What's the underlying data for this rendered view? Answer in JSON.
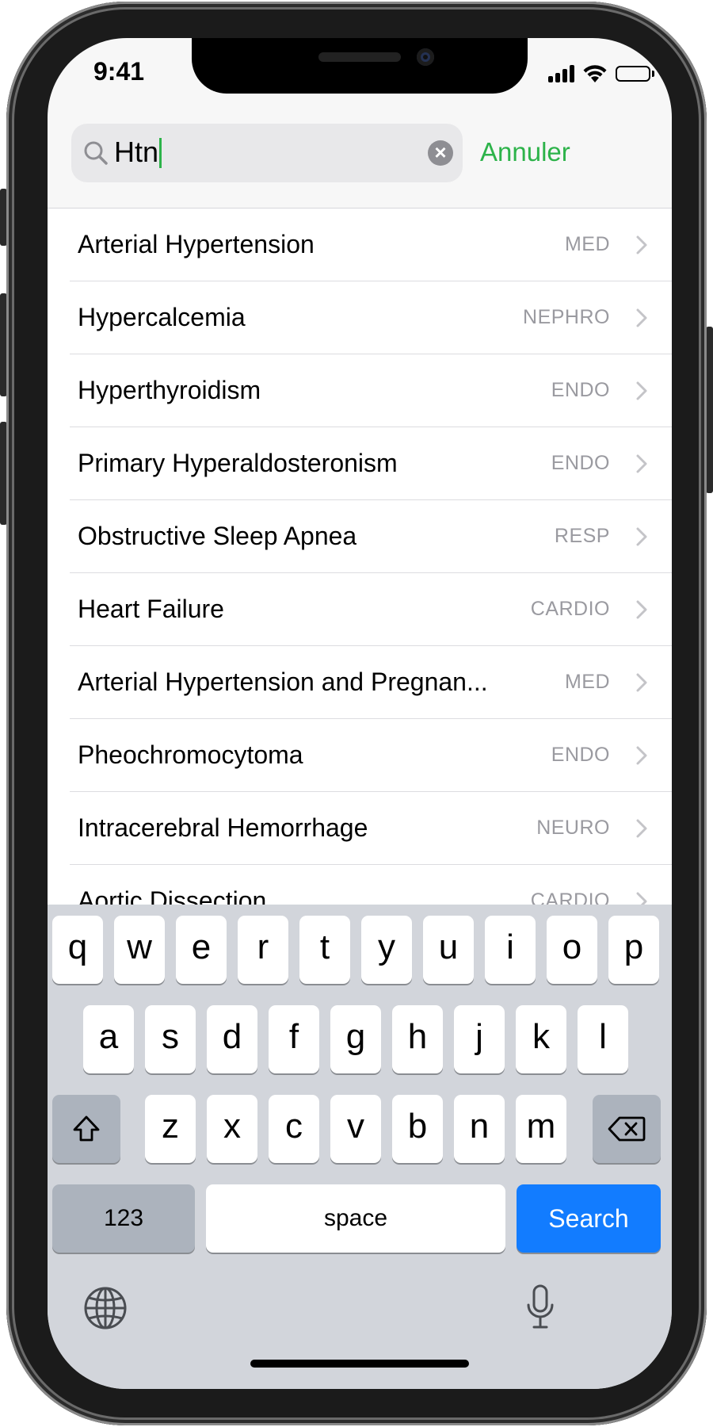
{
  "status_bar": {
    "time": "9:41"
  },
  "search": {
    "query": "Htn",
    "cancel_label": "Annuler"
  },
  "results": [
    {
      "title": "Arterial Hypertension",
      "tag": "MED"
    },
    {
      "title": "Hypercalcemia",
      "tag": "NEPHRO"
    },
    {
      "title": "Hyperthyroidism",
      "tag": "ENDO"
    },
    {
      "title": "Primary Hyperaldosteronism",
      "tag": "ENDO"
    },
    {
      "title": "Obstructive Sleep Apnea",
      "tag": "RESP"
    },
    {
      "title": "Heart Failure",
      "tag": "CARDIO"
    },
    {
      "title": "Arterial Hypertension and Pregnan...",
      "tag": "MED"
    },
    {
      "title": "Pheochromocytoma",
      "tag": "ENDO"
    },
    {
      "title": "Intracerebral Hemorrhage",
      "tag": "NEURO"
    },
    {
      "title": "Aortic Dissection",
      "tag": "CARDIO"
    }
  ],
  "keyboard": {
    "row1": [
      "q",
      "w",
      "e",
      "r",
      "t",
      "y",
      "u",
      "i",
      "o",
      "p"
    ],
    "row2": [
      "a",
      "s",
      "d",
      "f",
      "g",
      "h",
      "j",
      "k",
      "l"
    ],
    "row3": [
      "z",
      "x",
      "c",
      "v",
      "b",
      "n",
      "m"
    ],
    "numbers_label": "123",
    "space_label": "space",
    "search_label": "Search"
  },
  "icons": {
    "search": "search-icon",
    "clear": "clear-icon",
    "chevron": "chevron-right-icon",
    "shift": "shift-icon",
    "delete": "delete-icon",
    "globe": "globe-icon",
    "microphone": "microphone-icon"
  },
  "colors": {
    "accent": "#2db34a",
    "search_key": "#127cff"
  }
}
